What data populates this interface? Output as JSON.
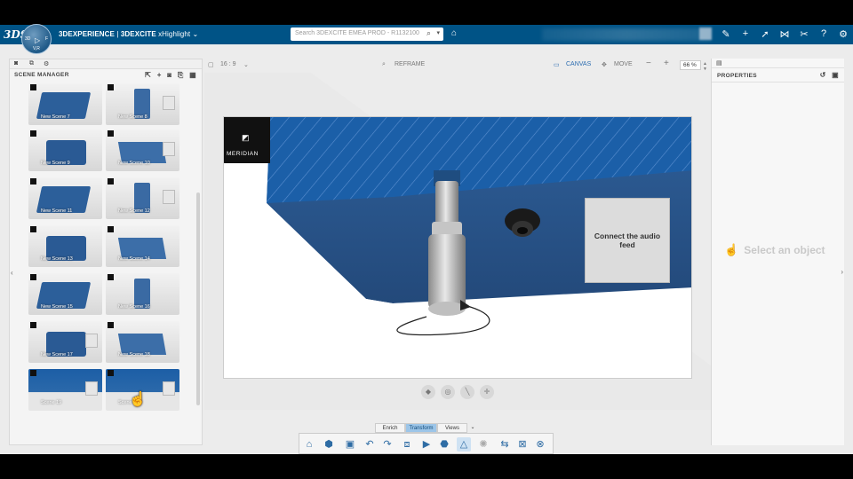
{
  "topbar": {
    "ds_logo": "3DS",
    "compass": {
      "n": "3D",
      "w": "▷",
      "e": "F",
      "s": "V,R"
    },
    "brand_strong": "3DEXPERIENCE",
    "brand_sep": " | ",
    "brand_app": "3DEXCITE",
    "brand_role": " xHighlight",
    "search_placeholder": "Search 3DEXCITE EMEA PROD - R1132100",
    "icons": [
      "tag-icon",
      "bookmark-icon",
      "plus-icon",
      "share-icon",
      "network-icon",
      "tools-icon",
      "help-icon",
      "settings-icon"
    ]
  },
  "left_panel": {
    "tabs": [
      "camera-icon",
      "objects-icon",
      "gear-icon"
    ],
    "title": "SCENE MANAGER",
    "scenes": [
      {
        "label": "New Scene 7"
      },
      {
        "label": "New Scene 8"
      },
      {
        "label": "New Scene 9"
      },
      {
        "label": "New Scene 10"
      },
      {
        "label": "New Scene 11"
      },
      {
        "label": "New Scene 12"
      },
      {
        "label": "New Scene 13"
      },
      {
        "label": "New Scene 14"
      },
      {
        "label": "New Scene 15"
      },
      {
        "label": "New Scene 16"
      },
      {
        "label": "New Scene 17"
      },
      {
        "label": "New Scene 18"
      },
      {
        "label": "Scene 19"
      },
      {
        "label": "Scene"
      }
    ]
  },
  "center_toolbar": {
    "ratio": "16 : 9",
    "reframe": "REFRAME",
    "canvas": "CANVAS",
    "move": "MOVE",
    "zoom": "66 %"
  },
  "scene": {
    "logo_text": "MERIDIAN",
    "card_text": "Connect the audio feed"
  },
  "bottom_tabs": [
    "Enrich",
    "Transform",
    "Views"
  ],
  "bottom_tabs_active": "Transform",
  "right_panel": {
    "title": "PROPERTIES",
    "empty_text": "Select an object"
  }
}
